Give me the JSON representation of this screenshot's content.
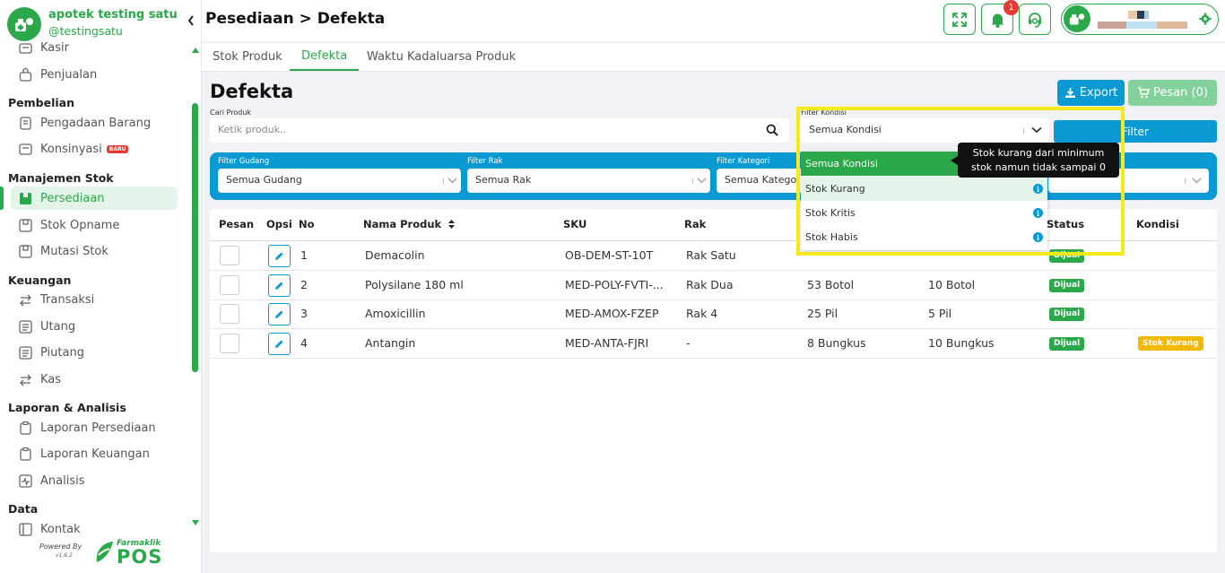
{
  "app": {
    "name": "apotek testing satu",
    "username": "@testingsatu",
    "powered_by": "Powered By",
    "version": "v1.6.2",
    "brand_small": "Farmaklik",
    "brand_big": "POS"
  },
  "sidebar": {
    "items_top": [
      {
        "label": "Kasir"
      },
      {
        "label": "Penjualan"
      }
    ],
    "sections": [
      {
        "title": "Pembelian",
        "items": [
          {
            "label": "Pengadaan Barang"
          },
          {
            "label": "Konsinyasi",
            "badge": "BARU"
          }
        ]
      },
      {
        "title": "Manajemen Stok",
        "items": [
          {
            "label": "Persediaan"
          },
          {
            "label": "Stok Opname"
          },
          {
            "label": "Mutasi Stok"
          }
        ]
      },
      {
        "title": "Keuangan",
        "items": [
          {
            "label": "Transaksi"
          },
          {
            "label": "Utang"
          },
          {
            "label": "Piutang"
          },
          {
            "label": "Kas"
          }
        ]
      },
      {
        "title": "Laporan & Analisis",
        "items": [
          {
            "label": "Laporan Persediaan"
          },
          {
            "label": "Laporan Keuangan"
          },
          {
            "label": "Analisis"
          }
        ]
      },
      {
        "title": "Data",
        "items": [
          {
            "label": "Kontak"
          }
        ]
      }
    ]
  },
  "header": {
    "breadcrumb": "Pesediaan > Defekta",
    "notification_count": "1"
  },
  "tabs": [
    {
      "label": "Stok Produk"
    },
    {
      "label": "Defekta"
    },
    {
      "label": "Waktu Kadaluarsa Produk"
    }
  ],
  "main": {
    "title": "Defekta",
    "export_label": "Export",
    "pesan_label": "Pesan (0)",
    "search_label": "Cari Produk",
    "search_placeholder": "Ketik produk..",
    "kondisi_label": "Filter Kondisi",
    "kondisi_value": "Semua Kondisi",
    "filter_button": "Filter",
    "filter_gudang_label": "Filter Gudang",
    "filter_gudang_value": "Semua Gudang",
    "filter_rak_label": "Filter Rak",
    "filter_rak_value": "Semua Rak",
    "filter_kategori_label": "Filter Kategori",
    "filter_kategori_value": "Semua Katego"
  },
  "dropdown": {
    "options": [
      {
        "label": "Semua Kondisi"
      },
      {
        "label": "Stok Kurang"
      },
      {
        "label": "Stok Kritis"
      },
      {
        "label": "Stok Habis"
      }
    ],
    "tooltip_line1": "Stok kurang dari minimum",
    "tooltip_line2": "stok namun tidak sampai 0",
    "info_glyph": "i"
  },
  "table": {
    "headers": {
      "pesan": "Pesan",
      "opsi": "Opsi",
      "no": "No",
      "nama": "Nama Produk",
      "sku": "SKU",
      "rak": "Rak",
      "status": "Status",
      "kondisi": "Kondisi"
    },
    "rows": [
      {
        "no": "1",
        "nama": "Demacolin",
        "sku": "OB-DEM-ST-10T",
        "rak": "Rak Satu",
        "stok": "",
        "min": "",
        "status": "Dijual",
        "kondisi": ""
      },
      {
        "no": "2",
        "nama": "Polysilane 180 ml",
        "sku": "MED-POLY-FVTI-...",
        "rak": "Rak Dua",
        "stok": "53 Botol",
        "min": "10 Botol",
        "status": "Dijual",
        "kondisi": ""
      },
      {
        "no": "3",
        "nama": "Amoxicillin",
        "sku": "MED-AMOX-FZEP",
        "rak": "Rak 4",
        "stok": "25 Pil",
        "min": "5 Pil",
        "status": "Dijual",
        "kondisi": ""
      },
      {
        "no": "4",
        "nama": "Antangin",
        "sku": "MED-ANTA-FJRI",
        "rak": "-",
        "stok": "8 Bungkus",
        "min": "10 Bungkus",
        "status": "Dijual",
        "kondisi": "Stok Kurang"
      }
    ]
  },
  "colors": {
    "primary_green": "#2aa84a",
    "primary_blue": "#0a9ad3",
    "warning": "#f5b800",
    "danger": "#e53935",
    "highlight": "#f7ea1a"
  }
}
